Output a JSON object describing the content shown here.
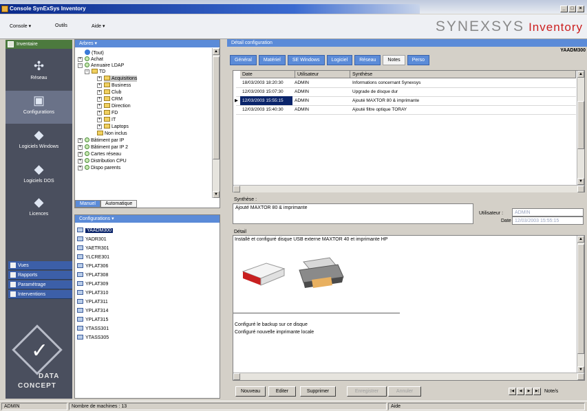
{
  "window": {
    "title": "Console SynExSys Inventory",
    "controls": [
      "_",
      "□",
      "×"
    ]
  },
  "menu": {
    "items": [
      "Console ▾",
      "Outils",
      "Aide ▾"
    ]
  },
  "brand": {
    "name": "SYNEXSYS",
    "product": "Inventory"
  },
  "nav": {
    "header": "Inventaire",
    "items": [
      {
        "label": "Réseau",
        "icon": "network-icon"
      },
      {
        "label": "Configurations",
        "icon": "computer-icon"
      },
      {
        "label": "Logiciels Windows",
        "icon": "software-icon"
      },
      {
        "label": "Logiciels DOS",
        "icon": "dos-software-icon"
      },
      {
        "label": "Licences",
        "icon": "license-icon"
      }
    ],
    "lists": [
      "Vues",
      "Rapports",
      "Paramétrage",
      "Interventions"
    ],
    "logo": [
      "DATA",
      "CONCEPT"
    ]
  },
  "tree": {
    "header": "Arbres ▾",
    "nodes": [
      {
        "label": "(Tout)"
      },
      {
        "label": "Achat"
      },
      {
        "label": "Annuaire LDAP"
      },
      {
        "label": "TD"
      },
      {
        "label": "Acquisitions"
      },
      {
        "label": "Business"
      },
      {
        "label": "Club"
      },
      {
        "label": "CRM"
      },
      {
        "label": "Direction"
      },
      {
        "label": "FD"
      },
      {
        "label": "IT"
      },
      {
        "label": "Laptops"
      },
      {
        "label": "Non inclus"
      },
      {
        "label": "Bâtiment par IP"
      },
      {
        "label": "Bâtiment par IP 2"
      },
      {
        "label": "Cartes réseau"
      },
      {
        "label": "Distribution CPU"
      },
      {
        "label": "Dispo parents"
      }
    ],
    "tabs": [
      "Manuel",
      "Automatique"
    ]
  },
  "configs": {
    "header": "Configurations ▾",
    "items": [
      "YAADM300",
      "YADR301",
      "YAETR301",
      "YLCRE301",
      "YPLAT306",
      "YPLAT308",
      "YPLAT309",
      "YPLAT310",
      "YPLAT311",
      "YPLAT314",
      "YPLAT315",
      "YTASS301",
      "YTASS305"
    ]
  },
  "detail": {
    "header": "Détail configuration",
    "machine": "YAADM300",
    "tabs": [
      "Général",
      "Matériel",
      "SE Windows",
      "Logiciel",
      "Réseau",
      "Notes",
      "Perso"
    ],
    "columns": [
      "Date",
      "Utilisateur",
      "Synthèse"
    ],
    "rows": [
      {
        "date": "18/03/2003 18:20:30",
        "user": "ADMIN",
        "summary": "Informations concernant Synexsys"
      },
      {
        "date": "12/03/2003 15:07:30",
        "user": "ADMIN",
        "summary": "Upgrade de disque dur"
      },
      {
        "date": "12/03/2003 15:55:15",
        "user": "ADMIN",
        "summary": "Ajouté MAXTOR 80 & imprimante"
      },
      {
        "date": "12/03/2003 15:40:30",
        "user": "ADMIN",
        "summary": "Ajouté filtre optique TORAY"
      }
    ],
    "synth_label": "Synthèse :",
    "synth_value": "Ajouté MAXTOR 80 & imprimante",
    "user_label": "Utilisateur :",
    "user_value": "ADMIN",
    "date_label": "Date :",
    "date_value": "12/03/2003 15:55:15",
    "detail_label": "Détail",
    "detail_text": "Installé et configuré disque USB externe MAXTOR 40 et imprimante HP",
    "detail_lines": [
      "Configuré le backup sur ce disque",
      "Configuré nouvelle imprimante locale"
    ],
    "buttons": [
      "Nouveau",
      "Editer",
      "Supprimer",
      "Enregistrer",
      "Annuler"
    ],
    "notes_count": "Note/s"
  },
  "status": {
    "user": "ADMIN",
    "machines": "Nombre de machines : 13",
    "help": "Aide"
  }
}
